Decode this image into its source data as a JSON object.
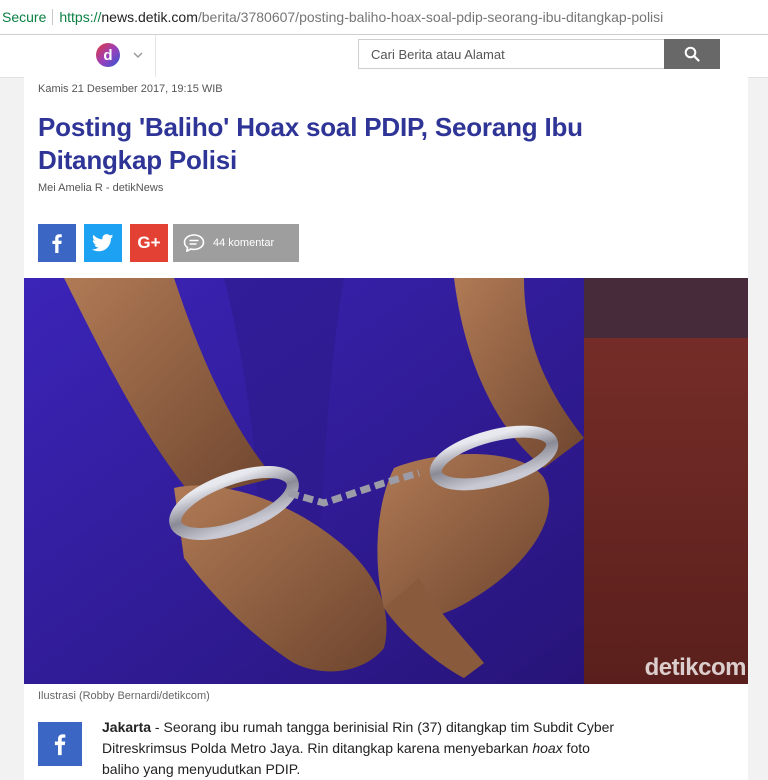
{
  "browser": {
    "secure_label": "Secure",
    "url_protocol": "https://",
    "url_host": "news.detik.com",
    "url_path": "/berita/3780607/posting-baliho-hoax-soal-pdip-seorang-ibu-ditangkap-polisi"
  },
  "header": {
    "logo_icon": "detik-logo-icon",
    "search_placeholder": "Cari Berita atau Alamat",
    "search_icon": "search-icon"
  },
  "article": {
    "date": "Kamis 21 Desember 2017, 19:15 WIB",
    "title": "Posting 'Baliho' Hoax soal PDIP, Seorang Ibu Ditangkap Polisi",
    "author": "Mei Amelia R - detikNews",
    "share": {
      "google_plus_label": "G+",
      "comment_count_label": "44 komentar"
    },
    "photo": {
      "watermark": "detikcom",
      "caption": "Ilustrasi (Robby Bernardi/detikcom)"
    },
    "lead": {
      "dateline": "Jakarta",
      "text_1": " - Seorang ibu rumah tangga berinisial Rin (37) ditangkap tim Subdit Cyber Ditreskrimsus Polda Metro Jaya. Rin ditangkap karena menyebarkan ",
      "hoax_word": "hoax",
      "text_2": " foto baliho yang menyudutkan PDIP."
    }
  },
  "colors": {
    "title": "#2f3597",
    "facebook": "#3b66c4",
    "twitter": "#1da1f2",
    "google_plus": "#e34133",
    "comment": "#9e9e9e",
    "search_button": "#686868",
    "secure_green": "#0b8043"
  }
}
